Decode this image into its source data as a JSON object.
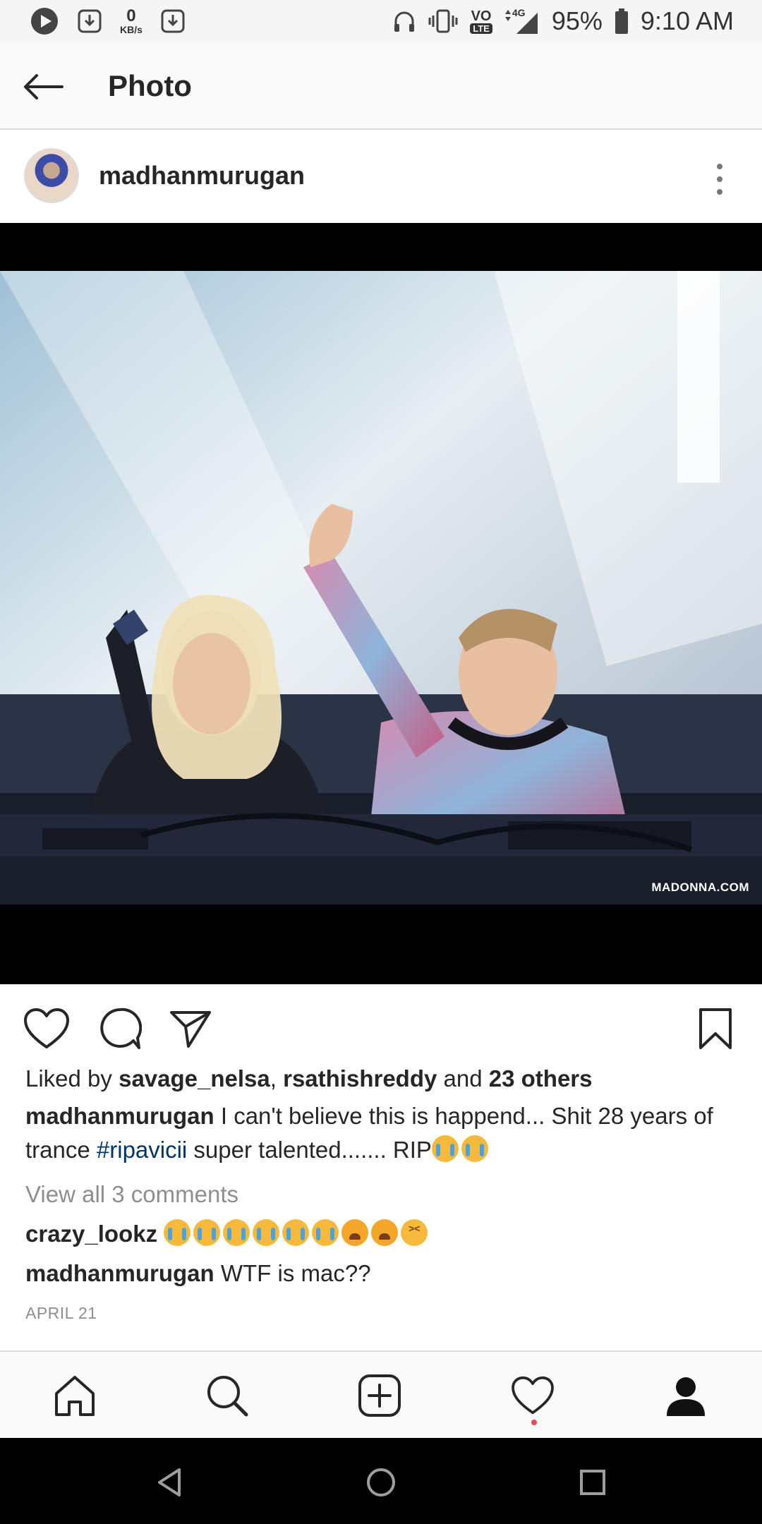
{
  "status_bar": {
    "net_speed_value": "0",
    "net_speed_unit": "KB/s",
    "network_type": "4G",
    "volte": "VO",
    "lte": "LTE",
    "battery": "95%",
    "time": "9:10 AM"
  },
  "header": {
    "title": "Photo"
  },
  "post": {
    "username": "madhanmurugan",
    "watermark": "MADONNA.COM",
    "likes": {
      "prefix": "Liked by ",
      "user1": "savage_nelsa",
      "sep": ", ",
      "user2": "rsathishreddy",
      "and": " and ",
      "others": "23 others"
    },
    "caption": {
      "username": "madhanmurugan",
      "text1": " I can't believe this is happend... Shit 28 years of trance ",
      "hashtag": "#ripavicii",
      "text2": " super talented....... RIP"
    },
    "view_all": "View all 3 comments",
    "comments": [
      {
        "username": "crazy_lookz",
        "text": ""
      },
      {
        "username": "madhanmurugan",
        "text": " WTF is mac??"
      }
    ],
    "date": "APRIL 21"
  },
  "icons": {
    "back": "arrow-left-icon",
    "more": "more-vertical-icon",
    "like": "heart-icon",
    "comment": "comment-icon",
    "share": "send-icon",
    "save": "bookmark-icon",
    "home": "home-icon",
    "search": "search-icon",
    "new_post": "add-post-icon",
    "activity": "heart-icon",
    "profile": "profile-icon"
  },
  "colors": {
    "hashtag": "#003569",
    "activity_dot": "#ed4956"
  }
}
